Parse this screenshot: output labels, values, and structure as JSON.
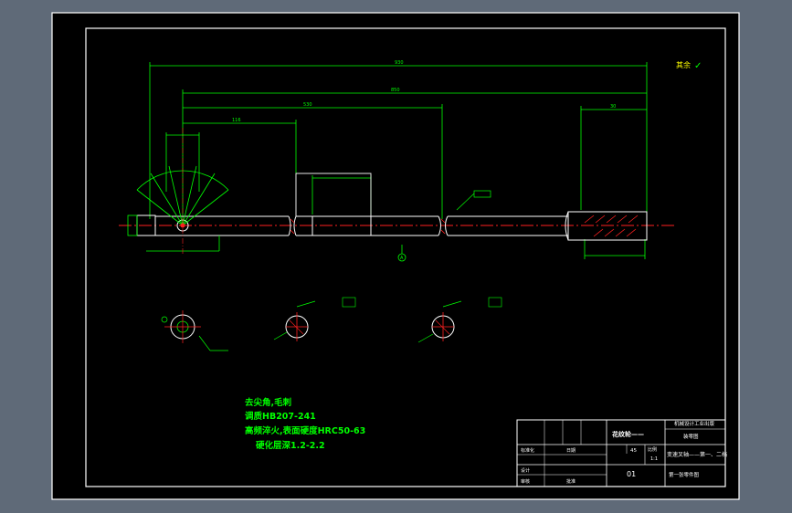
{
  "colors": {
    "canvas_bg": "#5f6a78",
    "sheet": "#000000",
    "frame": "#ffffff",
    "part_line": "#ffffff",
    "dimension": "#00ff00",
    "centerline": "#ff2020",
    "hatch": "#ff2020",
    "accent_cyan": "#00e5ff",
    "accent_yellow": "#ffff00",
    "note_text": "#00ff00"
  },
  "drawing": {
    "finish_mark": "其余",
    "finish_symbol": "✓",
    "overall_dim": "930",
    "dim_2": "850",
    "dim_3": "530",
    "dim_4": "116",
    "dim_5": "30",
    "section_marker": "A"
  },
  "notes": {
    "line1": "去尖角,毛刺",
    "line2": "调质HB207-241",
    "line3": "高频淬火,表面硬度HRC50-63",
    "line4": "硬化层深1.2-2.2"
  },
  "title_block": {
    "institute": "机械设计工业出版",
    "drawing_type": "装零图",
    "code": "花纹轮——",
    "part_name": "变速叉轴——第一、二档",
    "material": "45",
    "scale_label": "比例",
    "scale_value": "1:1",
    "sheet_no": "01",
    "sheet_label": "第一张零件图",
    "designer_label": "设计",
    "review_label": "审核",
    "approve_label": "批准",
    "std_label": "标准化",
    "date_label": "日期"
  }
}
